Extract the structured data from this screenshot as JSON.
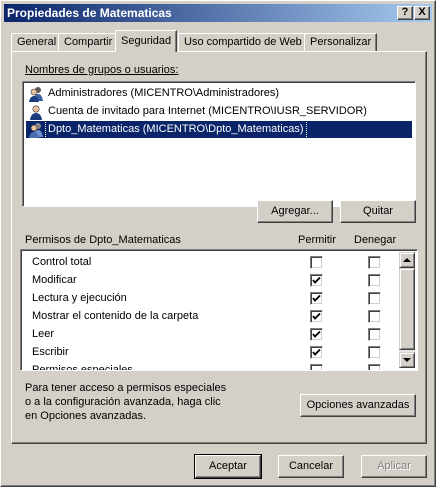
{
  "window": {
    "title": "Propiedades de Matematicas",
    "help_glyph": "?",
    "close_glyph": "X"
  },
  "tabs": [
    {
      "label": "General"
    },
    {
      "label": "Compartir"
    },
    {
      "label": "Seguridad"
    },
    {
      "label": "Uso compartido de Web"
    },
    {
      "label": "Personalizar"
    }
  ],
  "active_tab": "Seguridad",
  "users": {
    "label": "Nombres de grupos o usuarios:",
    "items": [
      {
        "name": "Administradores (MICENTRO\\Administradores)",
        "icon": "group-icon",
        "selected": false
      },
      {
        "name": "Cuenta de invitado para Internet (MICENTRO\\IUSR_SERVIDOR)",
        "icon": "user-icon",
        "selected": false
      },
      {
        "name": "Dpto_Matematicas (MICENTRO\\Dpto_Matematicas)",
        "icon": "group-icon",
        "selected": true
      }
    ],
    "add_button": "Agregar...",
    "remove_button": "Quitar"
  },
  "permissions": {
    "label": "Permisos de Dpto_Matematicas",
    "allow_header": "Permitir",
    "deny_header": "Denegar",
    "rows": [
      {
        "name": "Control total",
        "allow": false,
        "deny": false
      },
      {
        "name": "Modificar",
        "allow": true,
        "deny": false
      },
      {
        "name": "Lectura y ejecución",
        "allow": true,
        "deny": false
      },
      {
        "name": "Mostrar el contenido de la carpeta",
        "allow": true,
        "deny": false
      },
      {
        "name": "Leer",
        "allow": true,
        "deny": false
      },
      {
        "name": "Escribir",
        "allow": true,
        "deny": false
      },
      {
        "name": "Permisos especiales",
        "allow": false,
        "deny": false
      }
    ]
  },
  "advanced": {
    "text_line1": "Para tener acceso a permisos especiales",
    "text_line2": "o a la configuración avanzada, haga clic",
    "text_line3": "en Opciones avanzadas.",
    "button": "Opciones avanzadas"
  },
  "footer": {
    "accept": "Aceptar",
    "cancel": "Cancelar",
    "apply": "Aplicar"
  },
  "colors": {
    "title_gradient_start": "#0a246a",
    "title_gradient_end": "#a6caf0",
    "selection": "#0a246a",
    "face": "#d4d0c8"
  }
}
